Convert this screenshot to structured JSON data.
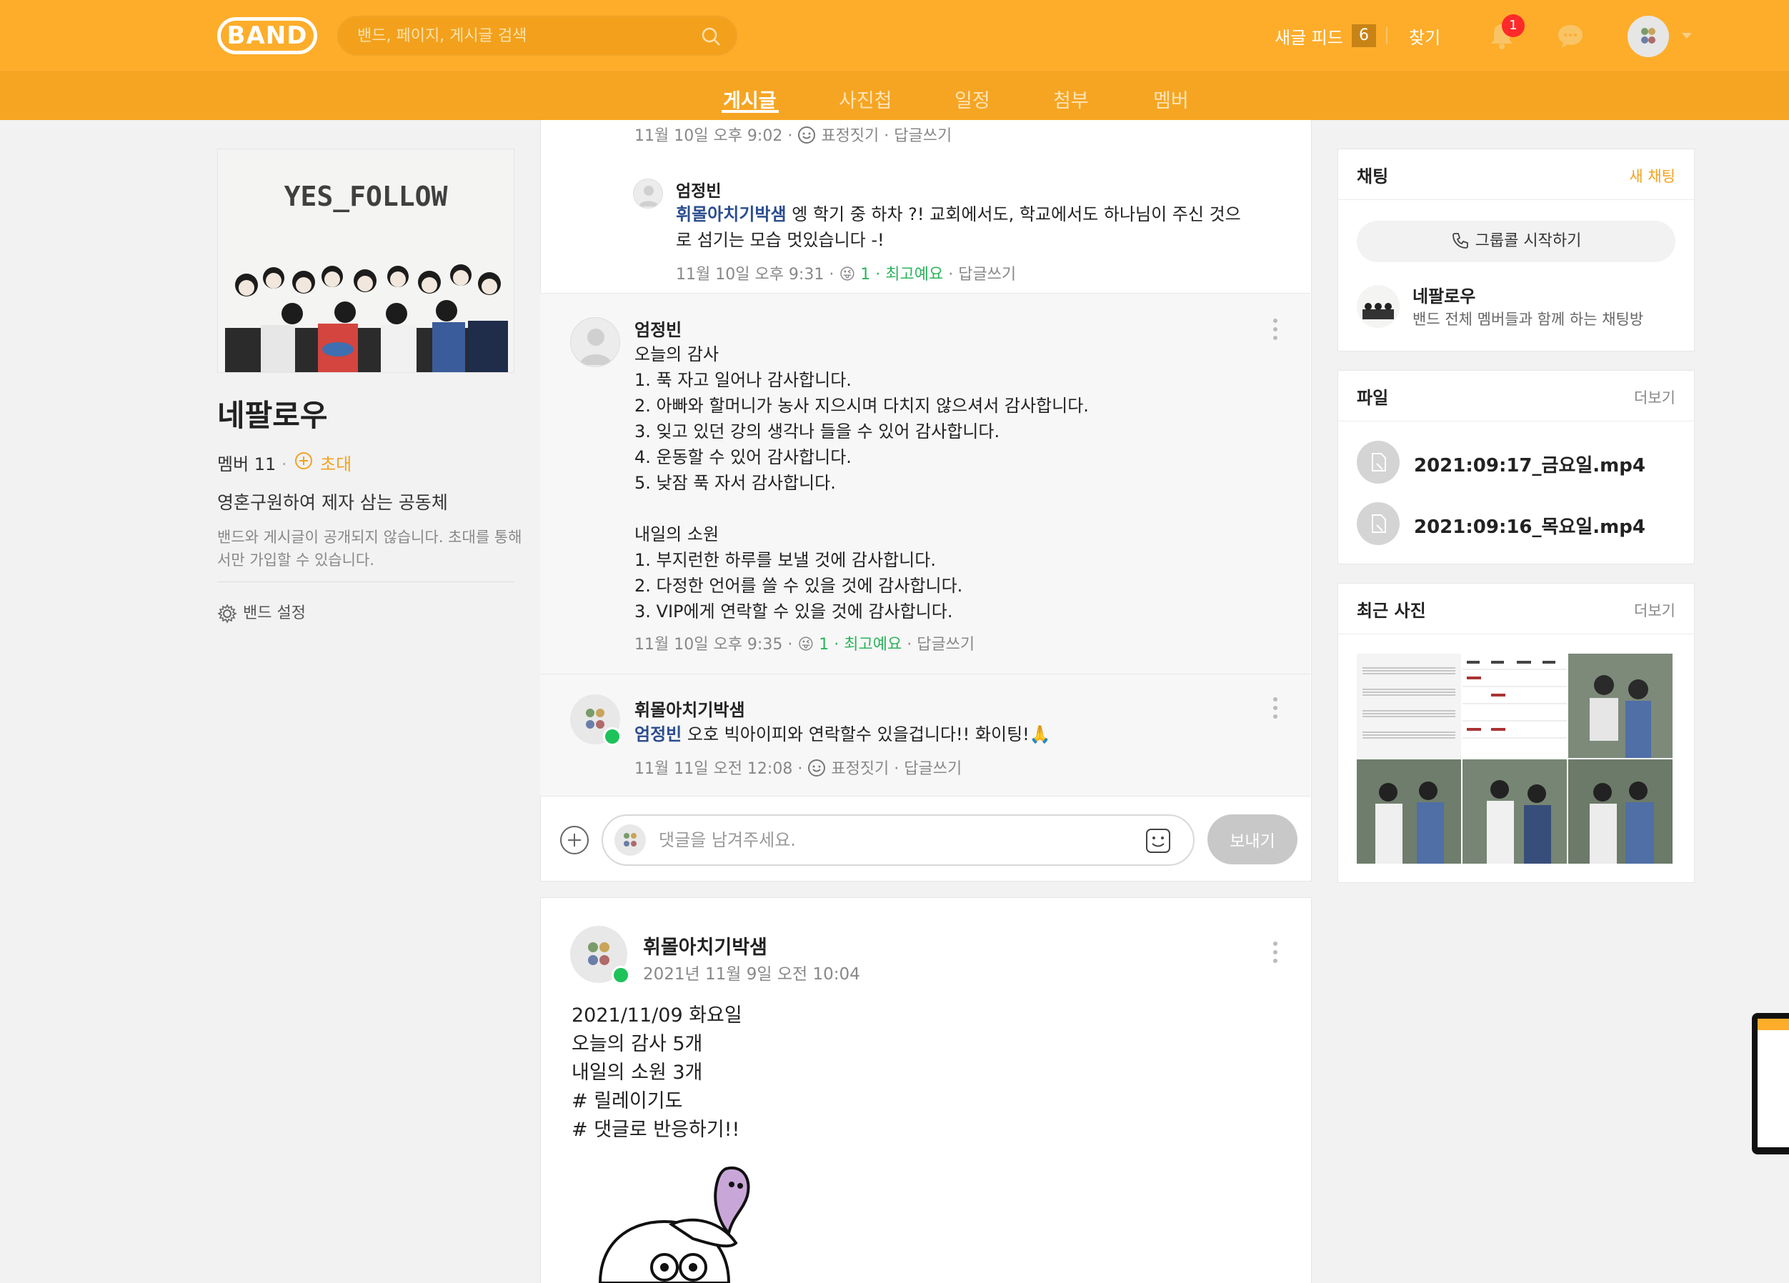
{
  "header": {
    "logo": "BAND",
    "search_placeholder": "밴드, 페이지, 게시글 검색",
    "new_feed_label": "새글 피드",
    "new_feed_count": "6",
    "find_label": "찾기",
    "notification_count": "1"
  },
  "tabs": [
    {
      "label": "게시글"
    },
    {
      "label": "사진첩"
    },
    {
      "label": "일정"
    },
    {
      "label": "첨부"
    },
    {
      "label": "멤버"
    }
  ],
  "band": {
    "cover_title": "YES_FOLLOW",
    "name": "네팔로우",
    "member_label": "멤버 11",
    "invite_label": "초대",
    "description": "영혼구원하여 제자 삼는 공동체",
    "privacy_note": "밴드와 게시글이 공개되지 않습니다. 초대를 통해서만 가입할 수 있습니다.",
    "settings_label": "밴드 설정"
  },
  "comments": [
    {
      "meta": "11월 10일 오후 9:02 ·",
      "action1": "표정짓기",
      "action2": "답글쓰기"
    },
    {
      "author": "엄정빈",
      "mention": "휘몰아치기박샘",
      "text": " 엥 학기 중 하차 ?! 교회에서도, 학교에서도 하나님이 주신 것으로 섬기는 모습 멋있습니다 -!",
      "meta": "11월 10일 오후 9:31 ·",
      "reaction_count": "1",
      "reaction_label": "최고예요",
      "reply": "답글쓰기"
    },
    {
      "author": "엄정빈",
      "lines": [
        "오늘의 감사",
        "1. 푹 자고 일어나 감사합니다.",
        "2. 아빠와 할머니가 농사 지으시며 다치지 않으셔서 감사합니다.",
        "3. 잊고 있던 강의 생각나 들을 수 있어 감사합니다.",
        "4. 운동할 수 있어 감사합니다.",
        "5. 낮잠 푹 자서 감사합니다.",
        "",
        "내일의 소원",
        "1. 부지런한 하루를 보낼 것에 감사합니다.",
        "2. 다정한 언어를 쓸 수 있을 것에 감사합니다.",
        "3. VIP에게 연락할 수 있을 것에 감사합니다."
      ],
      "meta": "11월 10일 오후 9:35 ·",
      "reaction_count": "1",
      "reaction_label": "최고예요",
      "reply": "답글쓰기"
    },
    {
      "author": "휘몰아치기박샘",
      "mention": "엄정빈",
      "text": "  오호 빅아이피와 연락할수 있을겁니다!! 화이팅!🙏",
      "meta": "11월 11일 오전 12:08 ·",
      "action1": "표정짓기",
      "action2": "답글쓰기"
    }
  ],
  "comment_input": {
    "placeholder": "댓글을 남겨주세요.",
    "send_label": "보내기"
  },
  "post": {
    "author": "휘몰아치기박샘",
    "date": "2021년 11월 9일 오전 10:04",
    "lines": [
      "2021/11/09 화요일",
      "오늘의 감사 5개",
      "내일의 소원 3개",
      "# 릴레이기도",
      "# 댓글로 반응하기!!"
    ]
  },
  "sidebar": {
    "chat": {
      "title": "채팅",
      "new_chat": "새 채팅",
      "group_call": "그룹콜 시작하기",
      "room_name": "네팔로우",
      "room_desc": "밴드 전체 멤버들과 함께 하는 채팅방"
    },
    "files": {
      "title": "파일",
      "more": "더보기",
      "items": [
        "2021:09:17_금요일.mp4",
        "2021:09:16_목요일.mp4"
      ]
    },
    "photos": {
      "title": "최근 사진",
      "more": "더보기"
    }
  },
  "colors": {
    "brand": "#fdad2a",
    "subnav": "#f6a522",
    "accent_orange": "#f4a21f",
    "reaction_green": "#2cb45c",
    "mention_blue": "#2b4d8f"
  }
}
